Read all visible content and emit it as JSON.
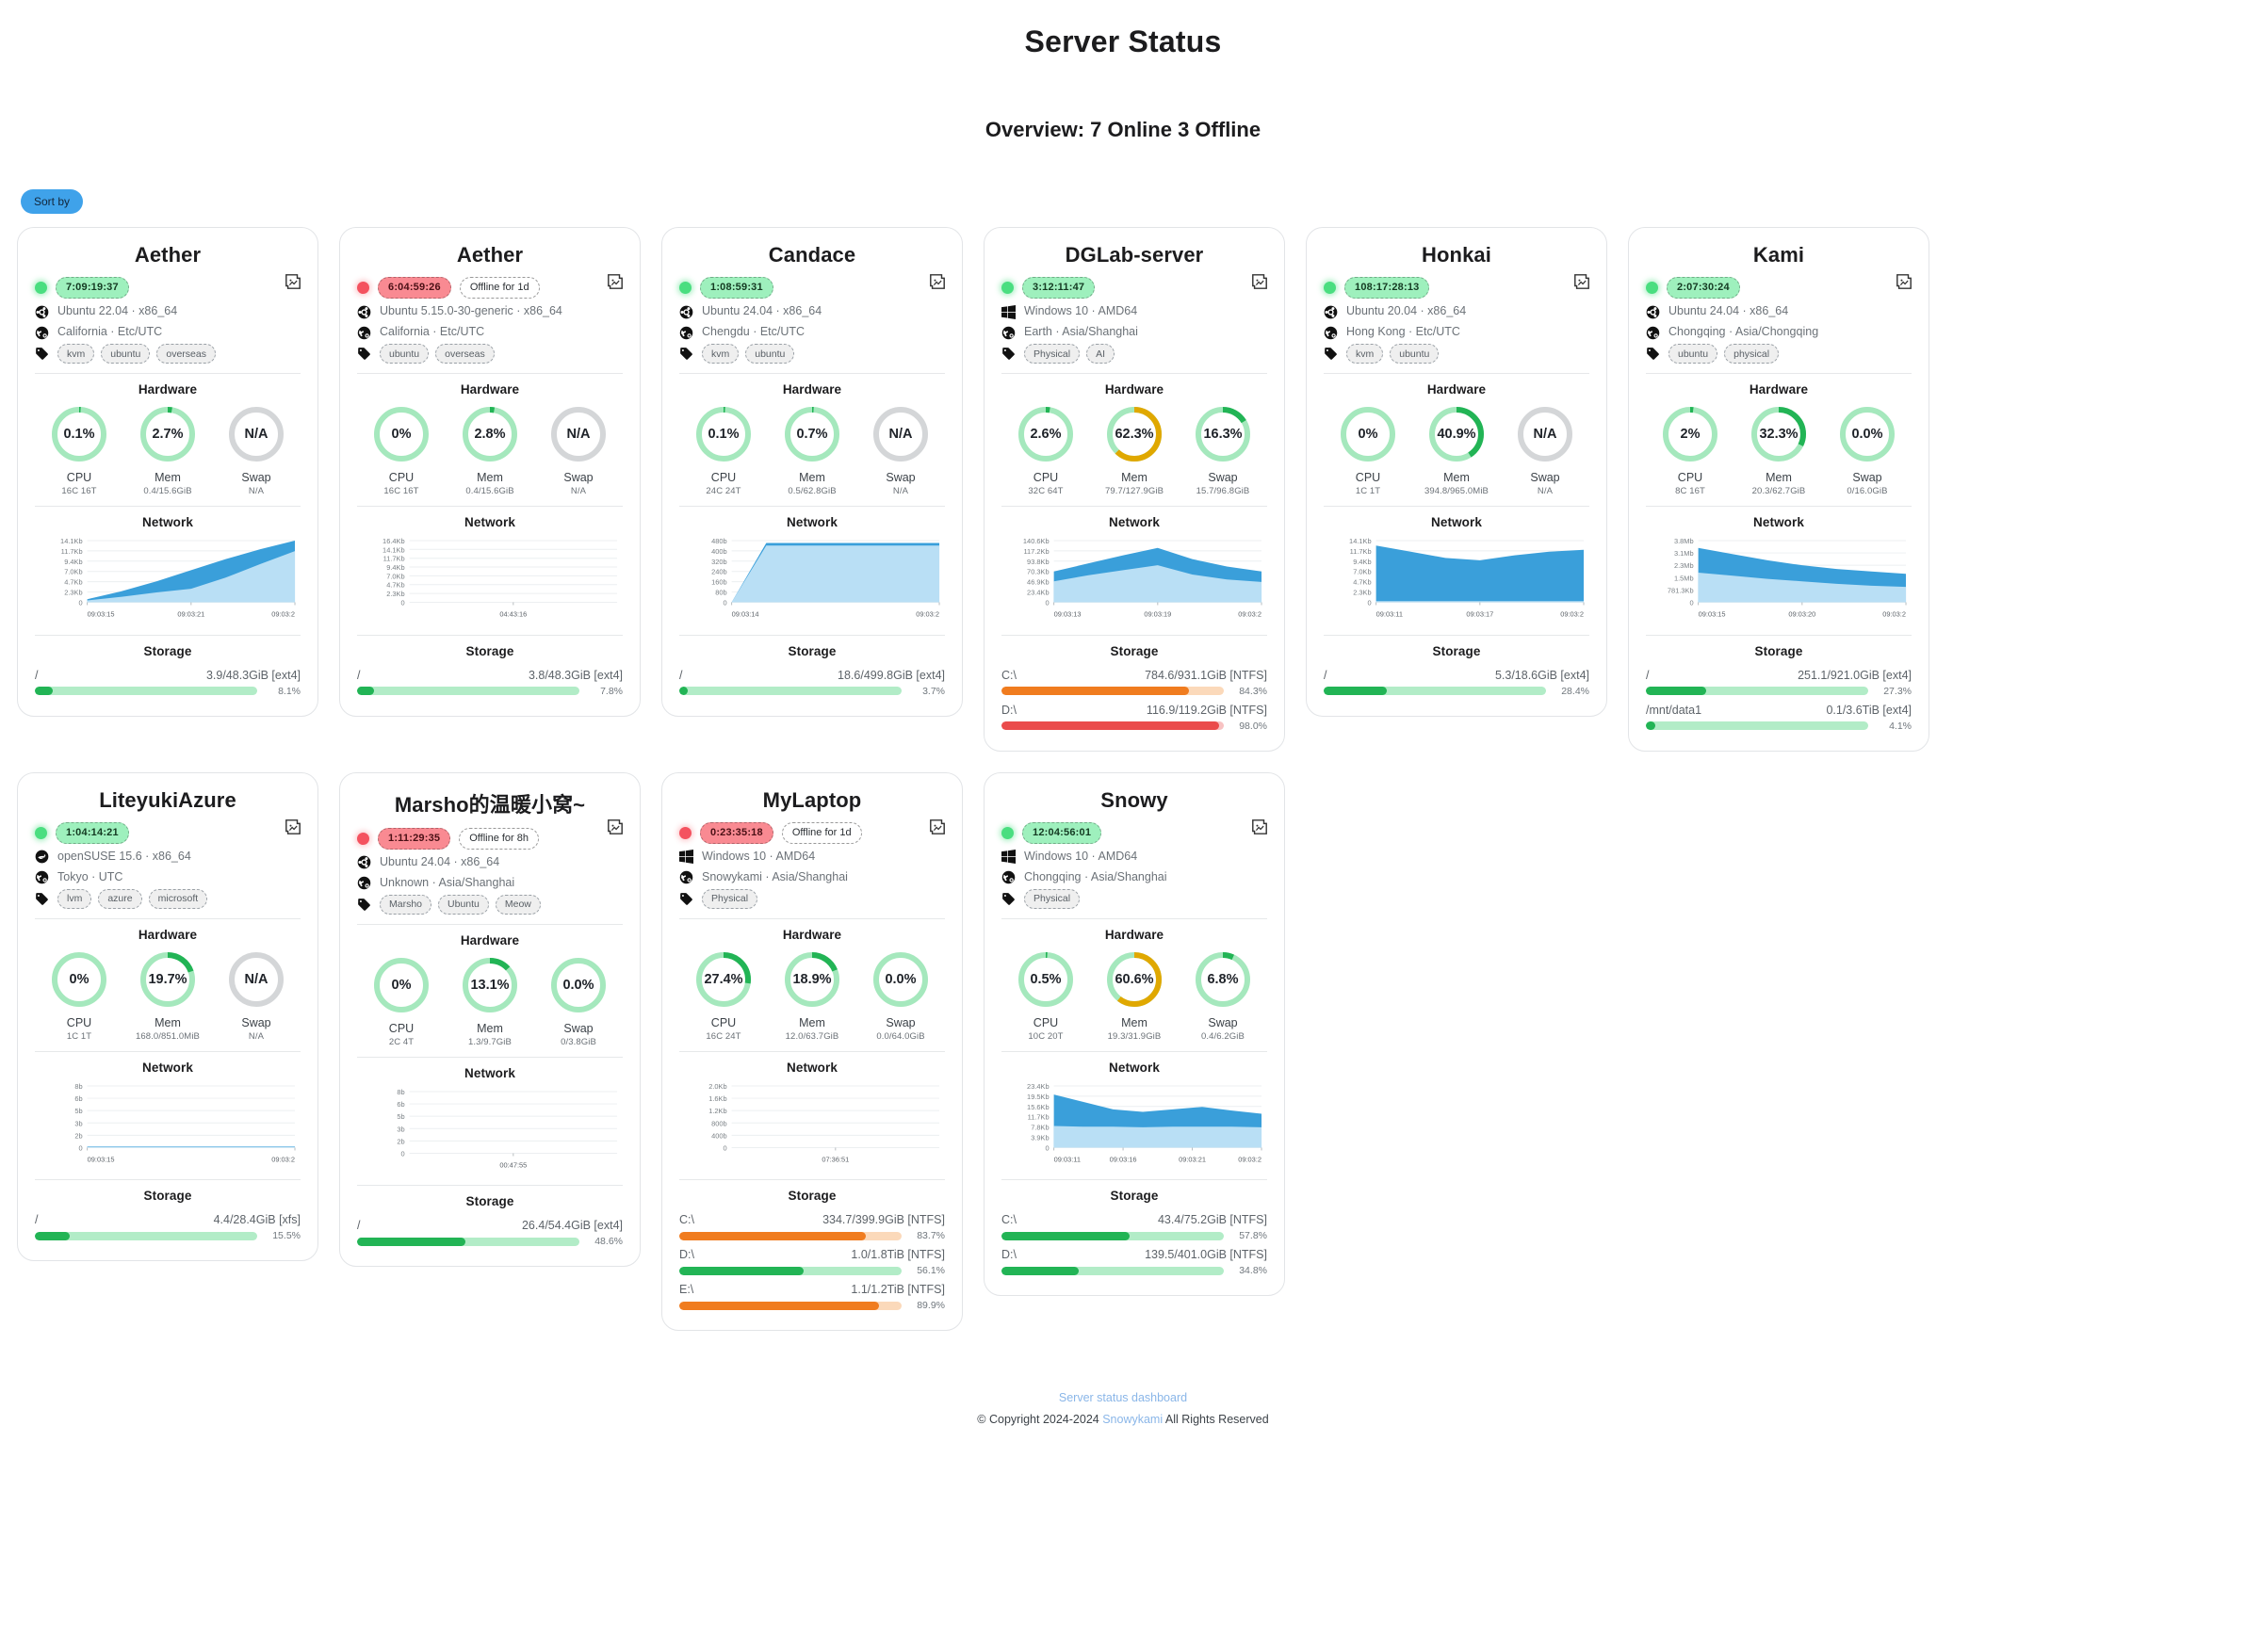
{
  "header": {
    "title": "Server Status",
    "overview": "Overview: 7 Online 3 Offline"
  },
  "toolbar": {
    "sort_label": "Sort by"
  },
  "labels": {
    "hardware": "Hardware",
    "network": "Network",
    "storage": "Storage",
    "cpu": "CPU",
    "mem": "Mem",
    "swap": "Swap"
  },
  "colors": {
    "online": "#4ade80",
    "offline": "#f4525f",
    "accent_blue": "#3fa2ea",
    "ring_low": "#a5e8bd",
    "ring_mid": "#22b455",
    "ring_high": "#e0a800",
    "ring_na": "#d4d6d8",
    "bar_green": "#22b455",
    "bar_orange": "#f07c1f",
    "bar_red": "#ea4b4b"
  },
  "footer": {
    "link": "Server status dashboard",
    "copyright_prefix": "© Copyright 2024-2024 ",
    "copyright_link": "Snowykami",
    "copyright_suffix": " All Rights Reserved"
  },
  "servers": [
    {
      "name": "Aether",
      "status": "online",
      "uptime": "7:09:19:37",
      "offline_for": "",
      "os": "Ubuntu 22.04 · x86_64",
      "os_icon": "ubuntu-icon",
      "location": "California · Etc/UTC",
      "tags": [
        "kvm",
        "ubuntu",
        "overseas"
      ],
      "cpu": {
        "value": "0.1%",
        "pct": 0.1,
        "sub": "16C 16T"
      },
      "mem": {
        "value": "2.7%",
        "pct": 2.7,
        "sub": "0.4/15.6GiB"
      },
      "swap": {
        "value": "N/A",
        "pct": null,
        "sub": "N/A"
      },
      "network": {
        "y_ticks": [
          "14.1Kb",
          "11.7Kb",
          "9.4Kb",
          "7.0Kb",
          "4.7Kb",
          "2.3Kb",
          "0"
        ],
        "x_ticks": [
          "09:03:15",
          "09:03:21",
          "09:03:2"
        ],
        "up": [
          5,
          18,
          34,
          52,
          70,
          86,
          100
        ],
        "down": [
          3,
          9,
          16,
          22,
          40,
          62,
          83
        ]
      },
      "storage": [
        {
          "mount": "/",
          "size": "3.9/48.3GiB [ext4]",
          "pct": 8.1,
          "pct_text": "8.1%",
          "level": "green"
        }
      ]
    },
    {
      "name": "Aether",
      "status": "offline",
      "uptime": "6:04:59:26",
      "offline_for": "Offline for 1d",
      "os": "Ubuntu 5.15.0-30-generic · x86_64",
      "os_icon": "ubuntu-icon",
      "location": "California · Etc/UTC",
      "tags": [
        "ubuntu",
        "overseas"
      ],
      "cpu": {
        "value": "0%",
        "pct": 0,
        "sub": "16C 16T"
      },
      "mem": {
        "value": "2.8%",
        "pct": 2.8,
        "sub": "0.4/15.6GiB"
      },
      "swap": {
        "value": "N/A",
        "pct": null,
        "sub": "N/A"
      },
      "network": {
        "y_ticks": [
          "16.4Kb",
          "14.1Kb",
          "11.7Kb",
          "9.4Kb",
          "7.0Kb",
          "4.7Kb",
          "2.3Kb",
          "0"
        ],
        "x_ticks": [
          "04:43:16"
        ],
        "up": [
          0,
          0,
          0,
          0,
          0,
          0,
          0
        ],
        "down": [
          0,
          0,
          0,
          0,
          0,
          0,
          0
        ]
      },
      "storage": [
        {
          "mount": "/",
          "size": "3.8/48.3GiB [ext4]",
          "pct": 7.8,
          "pct_text": "7.8%",
          "level": "green"
        }
      ]
    },
    {
      "name": "Candace",
      "status": "online",
      "uptime": "1:08:59:31",
      "offline_for": "",
      "os": "Ubuntu 24.04 · x86_64",
      "os_icon": "ubuntu-icon",
      "location": "Chengdu · Etc/UTC",
      "tags": [
        "kvm",
        "ubuntu"
      ],
      "cpu": {
        "value": "0.1%",
        "pct": 0.1,
        "sub": "24C 24T"
      },
      "mem": {
        "value": "0.7%",
        "pct": 0.7,
        "sub": "0.5/62.8GiB"
      },
      "swap": {
        "value": "N/A",
        "pct": null,
        "sub": "N/A"
      },
      "network": {
        "y_ticks": [
          "480b",
          "400b",
          "320b",
          "240b",
          "160b",
          "80b",
          "0"
        ],
        "x_ticks": [
          "09:03:14",
          "09:03:2"
        ],
        "up": [
          0,
          96,
          96,
          96,
          96,
          96,
          96
        ],
        "down": [
          0,
          92,
          92,
          92,
          92,
          92,
          92
        ]
      },
      "storage": [
        {
          "mount": "/",
          "size": "18.6/499.8GiB [ext4]",
          "pct": 3.7,
          "pct_text": "3.7%",
          "level": "green"
        }
      ]
    },
    {
      "name": "DGLab-server",
      "status": "online",
      "uptime": "3:12:11:47",
      "offline_for": "",
      "os": "Windows 10 · AMD64",
      "os_icon": "windows-icon",
      "location": "Earth · Asia/Shanghai",
      "tags": [
        "Physical",
        "AI"
      ],
      "cpu": {
        "value": "2.6%",
        "pct": 2.6,
        "sub": "32C 64T"
      },
      "mem": {
        "value": "62.3%",
        "pct": 62.3,
        "sub": "79.7/127.9GiB"
      },
      "swap": {
        "value": "16.3%",
        "pct": 16.3,
        "sub": "15.7/96.8GiB"
      },
      "network": {
        "y_ticks": [
          "140.6Kb",
          "117.2Kb",
          "93.8Kb",
          "70.3Kb",
          "46.9Kb",
          "23.4Kb",
          "0"
        ],
        "x_ticks": [
          "09:03:13",
          "09:03:19",
          "09:03:2"
        ],
        "up": [
          50,
          63,
          76,
          88,
          70,
          58,
          50
        ],
        "down": [
          34,
          44,
          52,
          60,
          45,
          37,
          33
        ]
      },
      "storage": [
        {
          "mount": "C:\\",
          "size": "784.6/931.1GiB [NTFS]",
          "pct": 84.3,
          "pct_text": "84.3%",
          "level": "orange"
        },
        {
          "mount": "D:\\",
          "size": "116.9/119.2GiB [NTFS]",
          "pct": 98.0,
          "pct_text": "98.0%",
          "level": "red"
        }
      ]
    },
    {
      "name": "Honkai",
      "status": "online",
      "uptime": "108:17:28:13",
      "offline_for": "",
      "os": "Ubuntu 20.04 · x86_64",
      "os_icon": "ubuntu-icon",
      "location": "Hong Kong · Etc/UTC",
      "tags": [
        "kvm",
        "ubuntu"
      ],
      "cpu": {
        "value": "0%",
        "pct": 0,
        "sub": "1C 1T"
      },
      "mem": {
        "value": "40.9%",
        "pct": 40.9,
        "sub": "394.8/965.0MiB"
      },
      "swap": {
        "value": "N/A",
        "pct": null,
        "sub": "N/A"
      },
      "network": {
        "y_ticks": [
          "14.1Kb",
          "11.7Kb",
          "9.4Kb",
          "7.0Kb",
          "4.7Kb",
          "2.3Kb",
          "0"
        ],
        "x_ticks": [
          "09:03:11",
          "09:03:17",
          "09:03:2"
        ],
        "up": [
          92,
          82,
          72,
          68,
          76,
          82,
          85
        ],
        "down": [
          2,
          2,
          2,
          2,
          2,
          2,
          2
        ]
      },
      "storage": [
        {
          "mount": "/",
          "size": "5.3/18.6GiB [ext4]",
          "pct": 28.4,
          "pct_text": "28.4%",
          "level": "green"
        }
      ]
    },
    {
      "name": "Kami",
      "status": "online",
      "uptime": "2:07:30:24",
      "offline_for": "",
      "os": "Ubuntu 24.04 · x86_64",
      "os_icon": "ubuntu-icon",
      "location": "Chongqing · Asia/Chongqing",
      "tags": [
        "ubuntu",
        "physical"
      ],
      "cpu": {
        "value": "2%",
        "pct": 2,
        "sub": "8C 16T"
      },
      "mem": {
        "value": "32.3%",
        "pct": 32.3,
        "sub": "20.3/62.7GiB"
      },
      "swap": {
        "value": "0.0%",
        "pct": 0,
        "sub": "0/16.0GiB"
      },
      "network": {
        "y_ticks": [
          "3.8Mb",
          "3.1Mb",
          "2.3Mb",
          "1.5Mb",
          "781.3Kb",
          "0"
        ],
        "x_ticks": [
          "09:03:15",
          "09:03:20",
          "09:03:2"
        ],
        "up": [
          88,
          78,
          68,
          60,
          54,
          50,
          46
        ],
        "down": [
          48,
          43,
          38,
          34,
          30,
          27,
          25
        ]
      },
      "storage": [
        {
          "mount": "/",
          "size": "251.1/921.0GiB [ext4]",
          "pct": 27.3,
          "pct_text": "27.3%",
          "level": "green"
        },
        {
          "mount": "/mnt/data1",
          "size": "0.1/3.6TiB [ext4]",
          "pct": 4.1,
          "pct_text": "4.1%",
          "level": "green"
        }
      ]
    },
    {
      "name": "LiteyukiAzure",
      "status": "online",
      "uptime": "1:04:14:21",
      "offline_for": "",
      "os": "openSUSE 15.6 · x86_64",
      "os_icon": "opensuse-icon",
      "location": "Tokyo · UTC",
      "tags": [
        "lvm",
        "azure",
        "microsoft"
      ],
      "cpu": {
        "value": "0%",
        "pct": 0,
        "sub": "1C 1T"
      },
      "mem": {
        "value": "19.7%",
        "pct": 19.7,
        "sub": "168.0/851.0MiB"
      },
      "swap": {
        "value": "N/A",
        "pct": null,
        "sub": "N/A"
      },
      "network": {
        "y_ticks": [
          "8b",
          "6b",
          "5b",
          "3b",
          "2b",
          "0"
        ],
        "x_ticks": [
          "09:03:15",
          "09:03:2"
        ],
        "up": [
          2,
          2,
          2,
          2,
          2,
          2,
          2
        ],
        "down": [
          1,
          1,
          1,
          1,
          1,
          1,
          1
        ]
      },
      "storage": [
        {
          "mount": "/",
          "size": "4.4/28.4GiB [xfs]",
          "pct": 15.5,
          "pct_text": "15.5%",
          "level": "green"
        }
      ]
    },
    {
      "name": "Marsho的温暖小窝~",
      "status": "offline",
      "uptime": "1:11:29:35",
      "offline_for": "Offline for 8h",
      "os": "Ubuntu 24.04 · x86_64",
      "os_icon": "ubuntu-icon",
      "location": "Unknown · Asia/Shanghai",
      "tags": [
        "Marsho",
        "Ubuntu",
        "Meow"
      ],
      "cpu": {
        "value": "0%",
        "pct": 0,
        "sub": "2C 4T"
      },
      "mem": {
        "value": "13.1%",
        "pct": 13.1,
        "sub": "1.3/9.7GiB"
      },
      "swap": {
        "value": "0.0%",
        "pct": 0,
        "sub": "0/3.8GiB"
      },
      "network": {
        "y_ticks": [
          "8b",
          "6b",
          "5b",
          "3b",
          "2b",
          "0"
        ],
        "x_ticks": [
          "00:47:55"
        ],
        "up": [
          0,
          0,
          0,
          0,
          0,
          0,
          0
        ],
        "down": [
          0,
          0,
          0,
          0,
          0,
          0,
          0
        ]
      },
      "storage": [
        {
          "mount": "/",
          "size": "26.4/54.4GiB [ext4]",
          "pct": 48.6,
          "pct_text": "48.6%",
          "level": "green"
        }
      ]
    },
    {
      "name": "MyLaptop",
      "status": "offline",
      "uptime": "0:23:35:18",
      "offline_for": "Offline for 1d",
      "os": "Windows 10 · AMD64",
      "os_icon": "windows-icon",
      "location": "Snowykami · Asia/Shanghai",
      "tags": [
        "Physical"
      ],
      "cpu": {
        "value": "27.4%",
        "pct": 27.4,
        "sub": "16C 24T"
      },
      "mem": {
        "value": "18.9%",
        "pct": 18.9,
        "sub": "12.0/63.7GiB"
      },
      "swap": {
        "value": "0.0%",
        "pct": 0,
        "sub": "0.0/64.0GiB"
      },
      "network": {
        "y_ticks": [
          "2.0Kb",
          "1.6Kb",
          "1.2Kb",
          "800b",
          "400b",
          "0"
        ],
        "x_ticks": [
          "07:36:51"
        ],
        "up": [
          0,
          0,
          0,
          0,
          0,
          0,
          0
        ],
        "down": [
          0,
          0,
          0,
          0,
          0,
          0,
          0
        ]
      },
      "storage": [
        {
          "mount": "C:\\",
          "size": "334.7/399.9GiB [NTFS]",
          "pct": 83.7,
          "pct_text": "83.7%",
          "level": "orange"
        },
        {
          "mount": "D:\\",
          "size": "1.0/1.8TiB [NTFS]",
          "pct": 56.1,
          "pct_text": "56.1%",
          "level": "green"
        },
        {
          "mount": "E:\\",
          "size": "1.1/1.2TiB [NTFS]",
          "pct": 89.9,
          "pct_text": "89.9%",
          "level": "orange"
        }
      ]
    },
    {
      "name": "Snowy",
      "status": "online",
      "uptime": "12:04:56:01",
      "offline_for": "",
      "os": "Windows 10 · AMD64",
      "os_icon": "windows-icon",
      "location": "Chongqing · Asia/Shanghai",
      "tags": [
        "Physical"
      ],
      "cpu": {
        "value": "0.5%",
        "pct": 0.5,
        "sub": "10C 20T"
      },
      "mem": {
        "value": "60.6%",
        "pct": 60.6,
        "sub": "19.3/31.9GiB"
      },
      "swap": {
        "value": "6.8%",
        "pct": 6.8,
        "sub": "0.4/6.2GiB"
      },
      "network": {
        "y_ticks": [
          "23.4Kb",
          "19.5Kb",
          "15.6Kb",
          "11.7Kb",
          "7.8Kb",
          "3.9Kb",
          "0"
        ],
        "x_ticks": [
          "09:03:11",
          "09:03:16",
          "09:03:21",
          "09:03:2"
        ],
        "up": [
          86,
          74,
          62,
          58,
          62,
          66,
          60,
          55
        ],
        "down": [
          35,
          34,
          34,
          33,
          34,
          34,
          34,
          33
        ]
      },
      "storage": [
        {
          "mount": "C:\\",
          "size": "43.4/75.2GiB [NTFS]",
          "pct": 57.8,
          "pct_text": "57.8%",
          "level": "green"
        },
        {
          "mount": "D:\\",
          "size": "139.5/401.0GiB [NTFS]",
          "pct": 34.8,
          "pct_text": "34.8%",
          "level": "green"
        }
      ]
    }
  ]
}
